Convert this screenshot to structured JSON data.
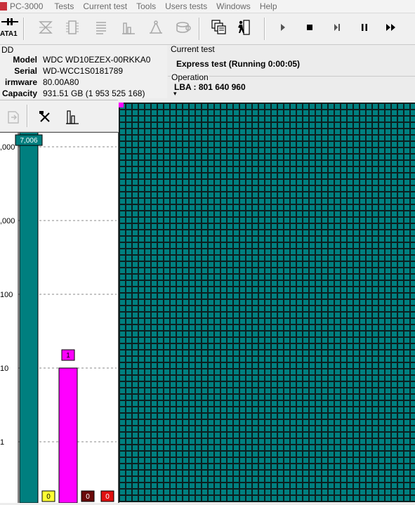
{
  "menubar": {
    "title": "PC-3000",
    "items": [
      "Tests",
      "Current test",
      "Tools",
      "Users tests",
      "Windows",
      "Help"
    ]
  },
  "toolbar": {
    "port_label": "ATA1"
  },
  "drive": {
    "header": "DD",
    "model_label": "Model",
    "model": "WDC WD10EZEX-00RKKA0",
    "serial_label": "Serial",
    "serial": "WD-WCC1S0181789",
    "firmware_label": "irmware",
    "firmware": "80.00A80",
    "capacity_label": "Capacity",
    "capacity": "931.51 GB (1 953 525 168)"
  },
  "current_test": {
    "title": "Current test",
    "status": "Express test (Running 0:00:05)"
  },
  "operation": {
    "title": "Operation",
    "value": "LBA : 801 640 960",
    "arrow": "▾"
  },
  "chart_data": {
    "type": "bar",
    "yscale": "log",
    "ylim": [
      0.1,
      10000
    ],
    "ytick_labels": [
      ",000",
      ",000",
      "100",
      "10",
      "1"
    ],
    "values": [
      7006,
      0,
      1,
      0,
      0
    ],
    "bar_labels": [
      "7,006",
      "0",
      "1",
      "0",
      "0"
    ],
    "colors": [
      "#007f7f",
      "#ffff33",
      "#ff00ff",
      "#6a0a0a",
      "#e01010"
    ]
  },
  "colors": {
    "grid_block": "#008080",
    "grid_line": "#0d1f1f",
    "cursor": "#ff00ff"
  }
}
